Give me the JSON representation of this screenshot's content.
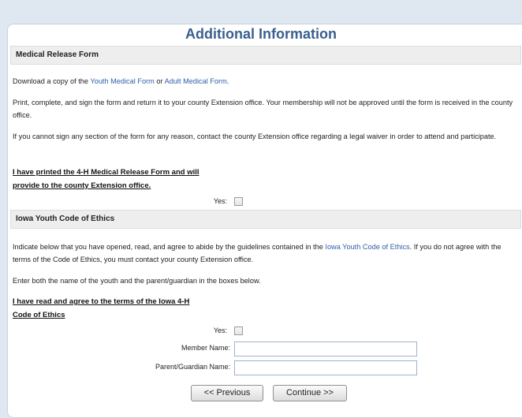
{
  "page": {
    "title": "Additional Information"
  },
  "medical": {
    "header": "Medical Release Form",
    "download_prefix": "Download a copy of the ",
    "youth_link": "Youth Medical Form",
    "or": " or ",
    "adult_link": "Adult Medical Form",
    "period": ".",
    "para2": "Print, complete, and sign the form and return it to your county Extension office. Your membership will not be approved until the form is received in the county office.",
    "para3": "If you cannot sign any section of the form for any reason, contact the county Extension office regarding a legal waiver in order to attend and participate.",
    "agree_line1": "I have printed the 4-H Medical Release Form and will",
    "agree_line2": "provide to the county Extension office.",
    "yes_label": "Yes:",
    "yes_checked": false
  },
  "ethics": {
    "header": "Iowa Youth Code of Ethics",
    "para1_prefix": "Indicate below that you have opened, read, and agree to abide by the guidelines contained in the ",
    "ethics_link": "Iowa Youth Code of Ethics",
    "para1_suffix": ". If you do not agree with the terms of the Code of Ethics, you must contact your county Extension office.",
    "para2": "Enter both the name of the youth and the parent/guardian in the boxes below.",
    "agree_line1": "I have read and agree to the terms of the Iowa 4-H",
    "agree_line2": "Code of Ethics",
    "yes_label": "Yes:",
    "yes_checked": false,
    "member_label": "Member Name:",
    "member_value": "",
    "guardian_label": "Parent/Guardian Name:",
    "guardian_value": ""
  },
  "buttons": {
    "previous": "<< Previous",
    "continue": "Continue >>"
  }
}
